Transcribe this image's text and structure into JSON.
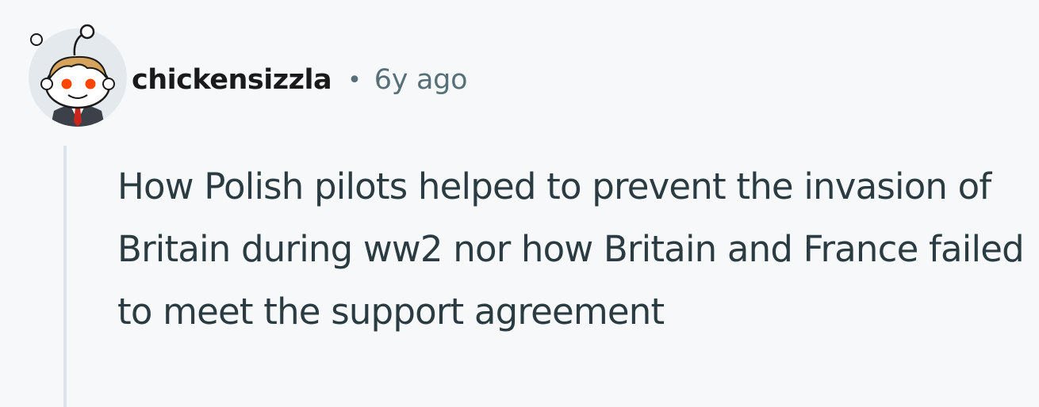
{
  "comment": {
    "author": "chickensizzla",
    "separator": "•",
    "timestamp": "6y ago",
    "body": "How Polish pilots helped to prevent the invasion of Britain during ww2 nor how Britain and France failed to meet the support agreement",
    "avatar_icon": "snoo-avatar-icon"
  },
  "colors": {
    "background": "#f6f8fa",
    "author": "#1a1a1b",
    "meta": "#576f76",
    "body": "#2a3c42",
    "thread_line": "#dde3ea"
  }
}
